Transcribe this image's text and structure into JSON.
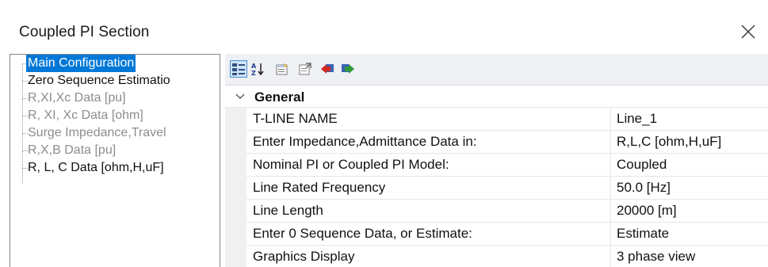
{
  "window": {
    "title": "Coupled PI Section",
    "close_icon": "close-icon"
  },
  "tree": {
    "items": [
      {
        "label": "Main Configuration",
        "state": "selected"
      },
      {
        "label": "Zero Sequence Estimatio",
        "state": "enabled"
      },
      {
        "label": "R,XI,Xc Data [pu]",
        "state": "disabled"
      },
      {
        "label": "R, XI, Xc Data [ohm]",
        "state": "disabled"
      },
      {
        "label": "Surge Impedance,Travel",
        "state": "disabled"
      },
      {
        "label": "R,X,B Data [pu]",
        "state": "disabled"
      },
      {
        "label": "R, L, C Data [ohm,H,uF]",
        "state": "enabled"
      }
    ]
  },
  "toolbar": {
    "buttons": [
      {
        "icon": "categorized-view-icon",
        "active": true
      },
      {
        "icon": "sort-alphabetical-icon",
        "active": false
      },
      {
        "icon": "property-pages-icon",
        "active": false
      },
      {
        "icon": "export-icon",
        "active": false
      },
      {
        "icon": "back-arrow-icon",
        "active": false
      },
      {
        "icon": "forward-arrow-icon",
        "active": false
      }
    ]
  },
  "grid": {
    "category": "General",
    "properties": [
      {
        "name": "T-LINE NAME",
        "value": "Line_1"
      },
      {
        "name": "Enter Impedance,Admittance Data in:",
        "value": "R,L,C [ohm,H,uF]"
      },
      {
        "name": "Nominal PI or Coupled PI Model:",
        "value": "Coupled"
      },
      {
        "name": "Line Rated Frequency",
        "value": "50.0 [Hz]"
      },
      {
        "name": "Line Length",
        "value": "20000 [m]"
      },
      {
        "name": "Enter 0 Sequence Data, or Estimate:",
        "value": "Estimate"
      },
      {
        "name": "Graphics Display",
        "value": "3 phase view"
      }
    ]
  },
  "colors": {
    "selection": "#0078d7",
    "disabled_text": "#8d8d8d",
    "toolbar_bg": "#eef0f4"
  }
}
